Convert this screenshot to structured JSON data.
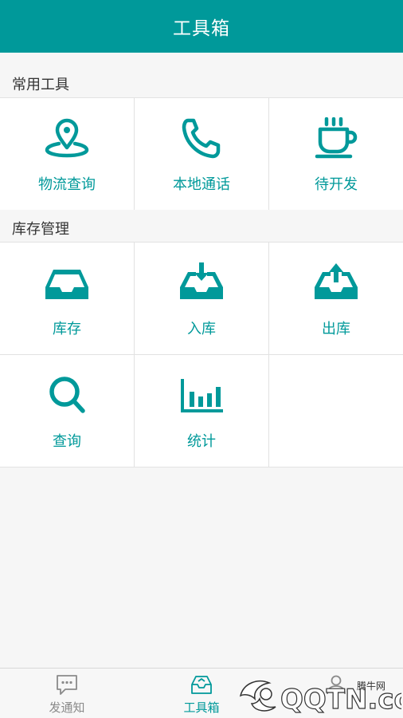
{
  "header": {
    "title": "工具箱"
  },
  "sections": [
    {
      "title": "常用工具",
      "items": [
        {
          "label": "物流查询",
          "icon": "location-pin-icon"
        },
        {
          "label": "本地通话",
          "icon": "phone-icon"
        },
        {
          "label": "待开发",
          "icon": "coffee-cup-icon"
        }
      ]
    },
    {
      "title": "库存管理",
      "items": [
        {
          "label": "库存",
          "icon": "inbox-tray-icon"
        },
        {
          "label": "入库",
          "icon": "inbox-in-icon"
        },
        {
          "label": "出库",
          "icon": "inbox-out-icon"
        },
        {
          "label": "查询",
          "icon": "search-icon"
        },
        {
          "label": "统计",
          "icon": "bar-chart-icon"
        }
      ]
    }
  ],
  "tabbar": {
    "items": [
      {
        "label": "发通知",
        "icon": "chat-bubble-icon",
        "active": false
      },
      {
        "label": "工具箱",
        "icon": "toolbox-icon",
        "active": true
      },
      {
        "label": "",
        "icon": "person-icon",
        "active": false
      }
    ]
  },
  "watermark": {
    "text": "QQTN.com",
    "subtext": "腾牛网"
  },
  "colors": {
    "accent": "#00999a",
    "background": "#f6f6f6",
    "divider": "#e2e2e2"
  }
}
